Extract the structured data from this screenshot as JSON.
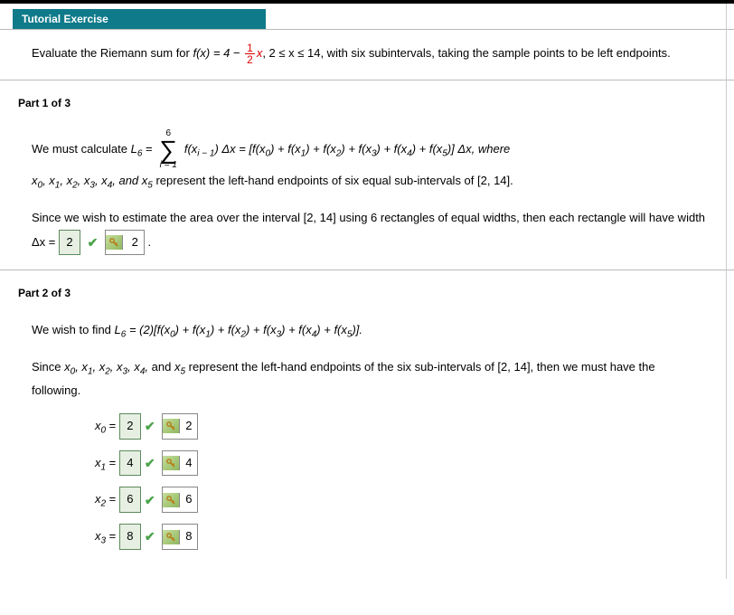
{
  "header": {
    "title": "Tutorial Exercise"
  },
  "exercise": {
    "prefix": "Evaluate the Riemann sum for ",
    "func_lhs": "f(x) = 4 − ",
    "frac_num": "1",
    "frac_den": "2",
    "after_frac": "x",
    "domain": ", 2 ≤ x ≤ 14,",
    "rest": "  with six subintervals, taking the sample points to be left endpoints."
  },
  "part1": {
    "label": "Part 1 of 3",
    "calc_prefix": "We must calculate  ",
    "L6": "L",
    "L6sub": "6",
    "eq": " = ",
    "sum_top": "6",
    "sum_bot": "i = 1",
    "summand": " f(x",
    "summand_sub": "i − 1",
    "summand_after": ") Δx = [f(x",
    "s0": "0",
    "sp1": ") + f(x",
    "s1": "1",
    "sp2": ") + f(x",
    "s2": "2",
    "sp3": ") + f(x",
    "s3": "3",
    "sp4": ") + f(x",
    "s4": "4",
    "sp5": ") + f(x",
    "s5": "5",
    "tail": ")] Δx,  where",
    "line2a": "x",
    "sub0": "0",
    "c": ", x",
    "sub1": "1",
    "sub2": "2",
    "sub3": "3",
    "sub4": "4",
    "line2b": ", and x",
    "sub5": "5",
    "line2c": "  represent the left-hand endpoints of six equal sub-intervals of  [2, 14].",
    "line3": "Since we wish to estimate the area over the interval  [2, 14]  using 6 rectangles of equal widths, then each rectangle will have width  Δx = ",
    "dx_input": "2",
    "dx_solution": "2",
    "period": " ."
  },
  "part2": {
    "label": "Part 2 of 3",
    "line1_a": "We wish to find  ",
    "L6": "L",
    "L6sub": "6",
    "line1_b": " = (2)[f(x",
    "s0": "0",
    "p": ") + f(x",
    "s1": "1",
    "s2": "2",
    "s3": "3",
    "s4": "4",
    "s5": "5",
    "line1_c": ")].",
    "line2": "Since  x₀, x₁, x₂, x₃, x₄, and x₅  represent the left-hand endpoints of the six sub-intervals of  [2, 14],  then we must have the following.",
    "rows": [
      {
        "var": "x",
        "sub": "0",
        "eq": " = ",
        "input": "2",
        "sol": "2"
      },
      {
        "var": "x",
        "sub": "1",
        "eq": " = ",
        "input": "4",
        "sol": "4"
      },
      {
        "var": "x",
        "sub": "2",
        "eq": " = ",
        "input": "6",
        "sol": "6"
      },
      {
        "var": "x",
        "sub": "3",
        "eq": " = ",
        "input": "8",
        "sol": "8"
      }
    ]
  }
}
